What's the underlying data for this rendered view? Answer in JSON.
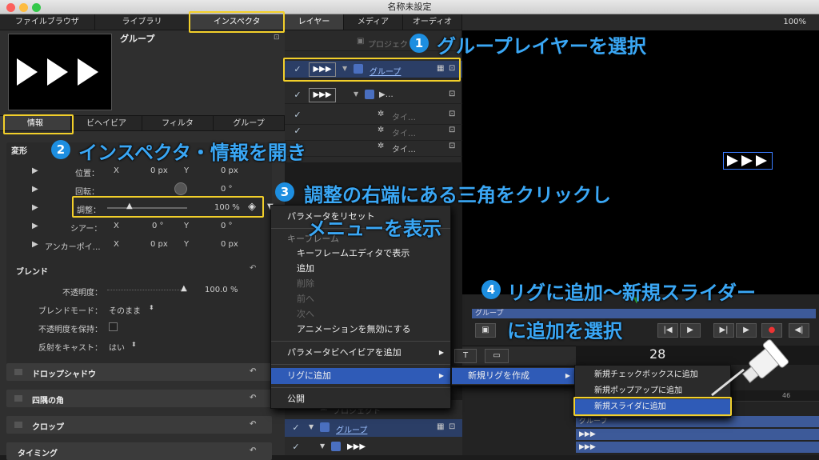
{
  "window": {
    "title": "名称未設定",
    "zoom": "100%"
  },
  "inspector": {
    "tabs": [
      "ファイルブラウザ",
      "ライブラリ",
      "インスペクタ"
    ],
    "object_name": "グループ",
    "subtabs": [
      "情報",
      "ビヘイビア",
      "フィルタ",
      "グループ"
    ],
    "transform": {
      "title": "変形",
      "position_label": "位置：",
      "position_x_axis": "X",
      "position_x": "0 px",
      "position_y_axis": "Y",
      "position_y": "0 px",
      "rotation_label": "回転：",
      "rotation_val": "0 °",
      "scale_label": "調整：",
      "scale_val": "100 %",
      "shear_label": "シアー：",
      "shear_x_axis": "X",
      "shear_x": "0 °",
      "shear_y_axis": "Y",
      "shear_y": "0 °",
      "anchor_label": "アンカーポイ…",
      "anchor_x_axis": "X",
      "anchor_x": "0 px",
      "anchor_y_axis": "Y",
      "anchor_y": "0 px"
    },
    "blend": {
      "title": "ブレンド",
      "opacity_label": "不透明度：",
      "opacity_val": "100.0",
      "opacity_unit": "%",
      "mode_label": "ブレンドモード：",
      "mode_val": "そのまま",
      "preserve_label": "不透明度を保持：",
      "cast_label": "反射をキャスト：",
      "cast_val": "はい"
    },
    "sections": [
      "ドロップシャドウ",
      "四隅の角",
      "クロップ",
      "タイミング"
    ]
  },
  "layers": {
    "tabs": [
      "レイヤー",
      "メディア",
      "オーディオ"
    ],
    "project": "プロジェクト",
    "group": "グループ",
    "sub_group": "▶…",
    "items": [
      "タイ…",
      "タイ…",
      "タイ…"
    ]
  },
  "context_menu": {
    "items": [
      {
        "label": "パラメータをリセット"
      },
      {
        "label": "キーフレーム",
        "header": true
      },
      {
        "label": "キーフレームエディタで表示"
      },
      {
        "label": "追加"
      },
      {
        "label": "削除",
        "disabled": true
      },
      {
        "label": "前へ",
        "disabled": true
      },
      {
        "label": "次へ",
        "disabled": true
      },
      {
        "label": "アニメーションを無効にする"
      },
      {
        "label": "パラメータビヘイビアを追加"
      },
      {
        "label": "リグに追加"
      },
      {
        "label": "公開"
      }
    ],
    "submenu1": "新規リグを作成",
    "submenu2": [
      "新規チェックボックスに追加",
      "新規ポップアップに追加",
      "新規スライダに追加"
    ]
  },
  "timeline": {
    "group_label": "グループ",
    "timecode": "28",
    "ruler_mark": "46",
    "bottom_rows": [
      "プロジェクト",
      "グループ",
      "▶▶▶"
    ],
    "track_labels": [
      "グループ",
      "▶▶▶",
      "▶▶▶"
    ]
  },
  "annotations": [
    {
      "n": "1",
      "text": "グループレイヤーを選択"
    },
    {
      "n": "2",
      "text": "インスペクタ・情報を開き"
    },
    {
      "n": "3",
      "text": "調整の右端にある三角をクリックし"
    },
    {
      "n": "",
      "text": "メニューを表示"
    },
    {
      "n": "4",
      "text": "リグに追加〜新規スライダー"
    },
    {
      "n": "",
      "text": "に追加を選択"
    }
  ],
  "colors": {
    "highlight": "#f2cf2a",
    "annotation": "#3aa7f5",
    "badge": "#1d8ee0",
    "menu_selected": "#2f5bb7"
  }
}
